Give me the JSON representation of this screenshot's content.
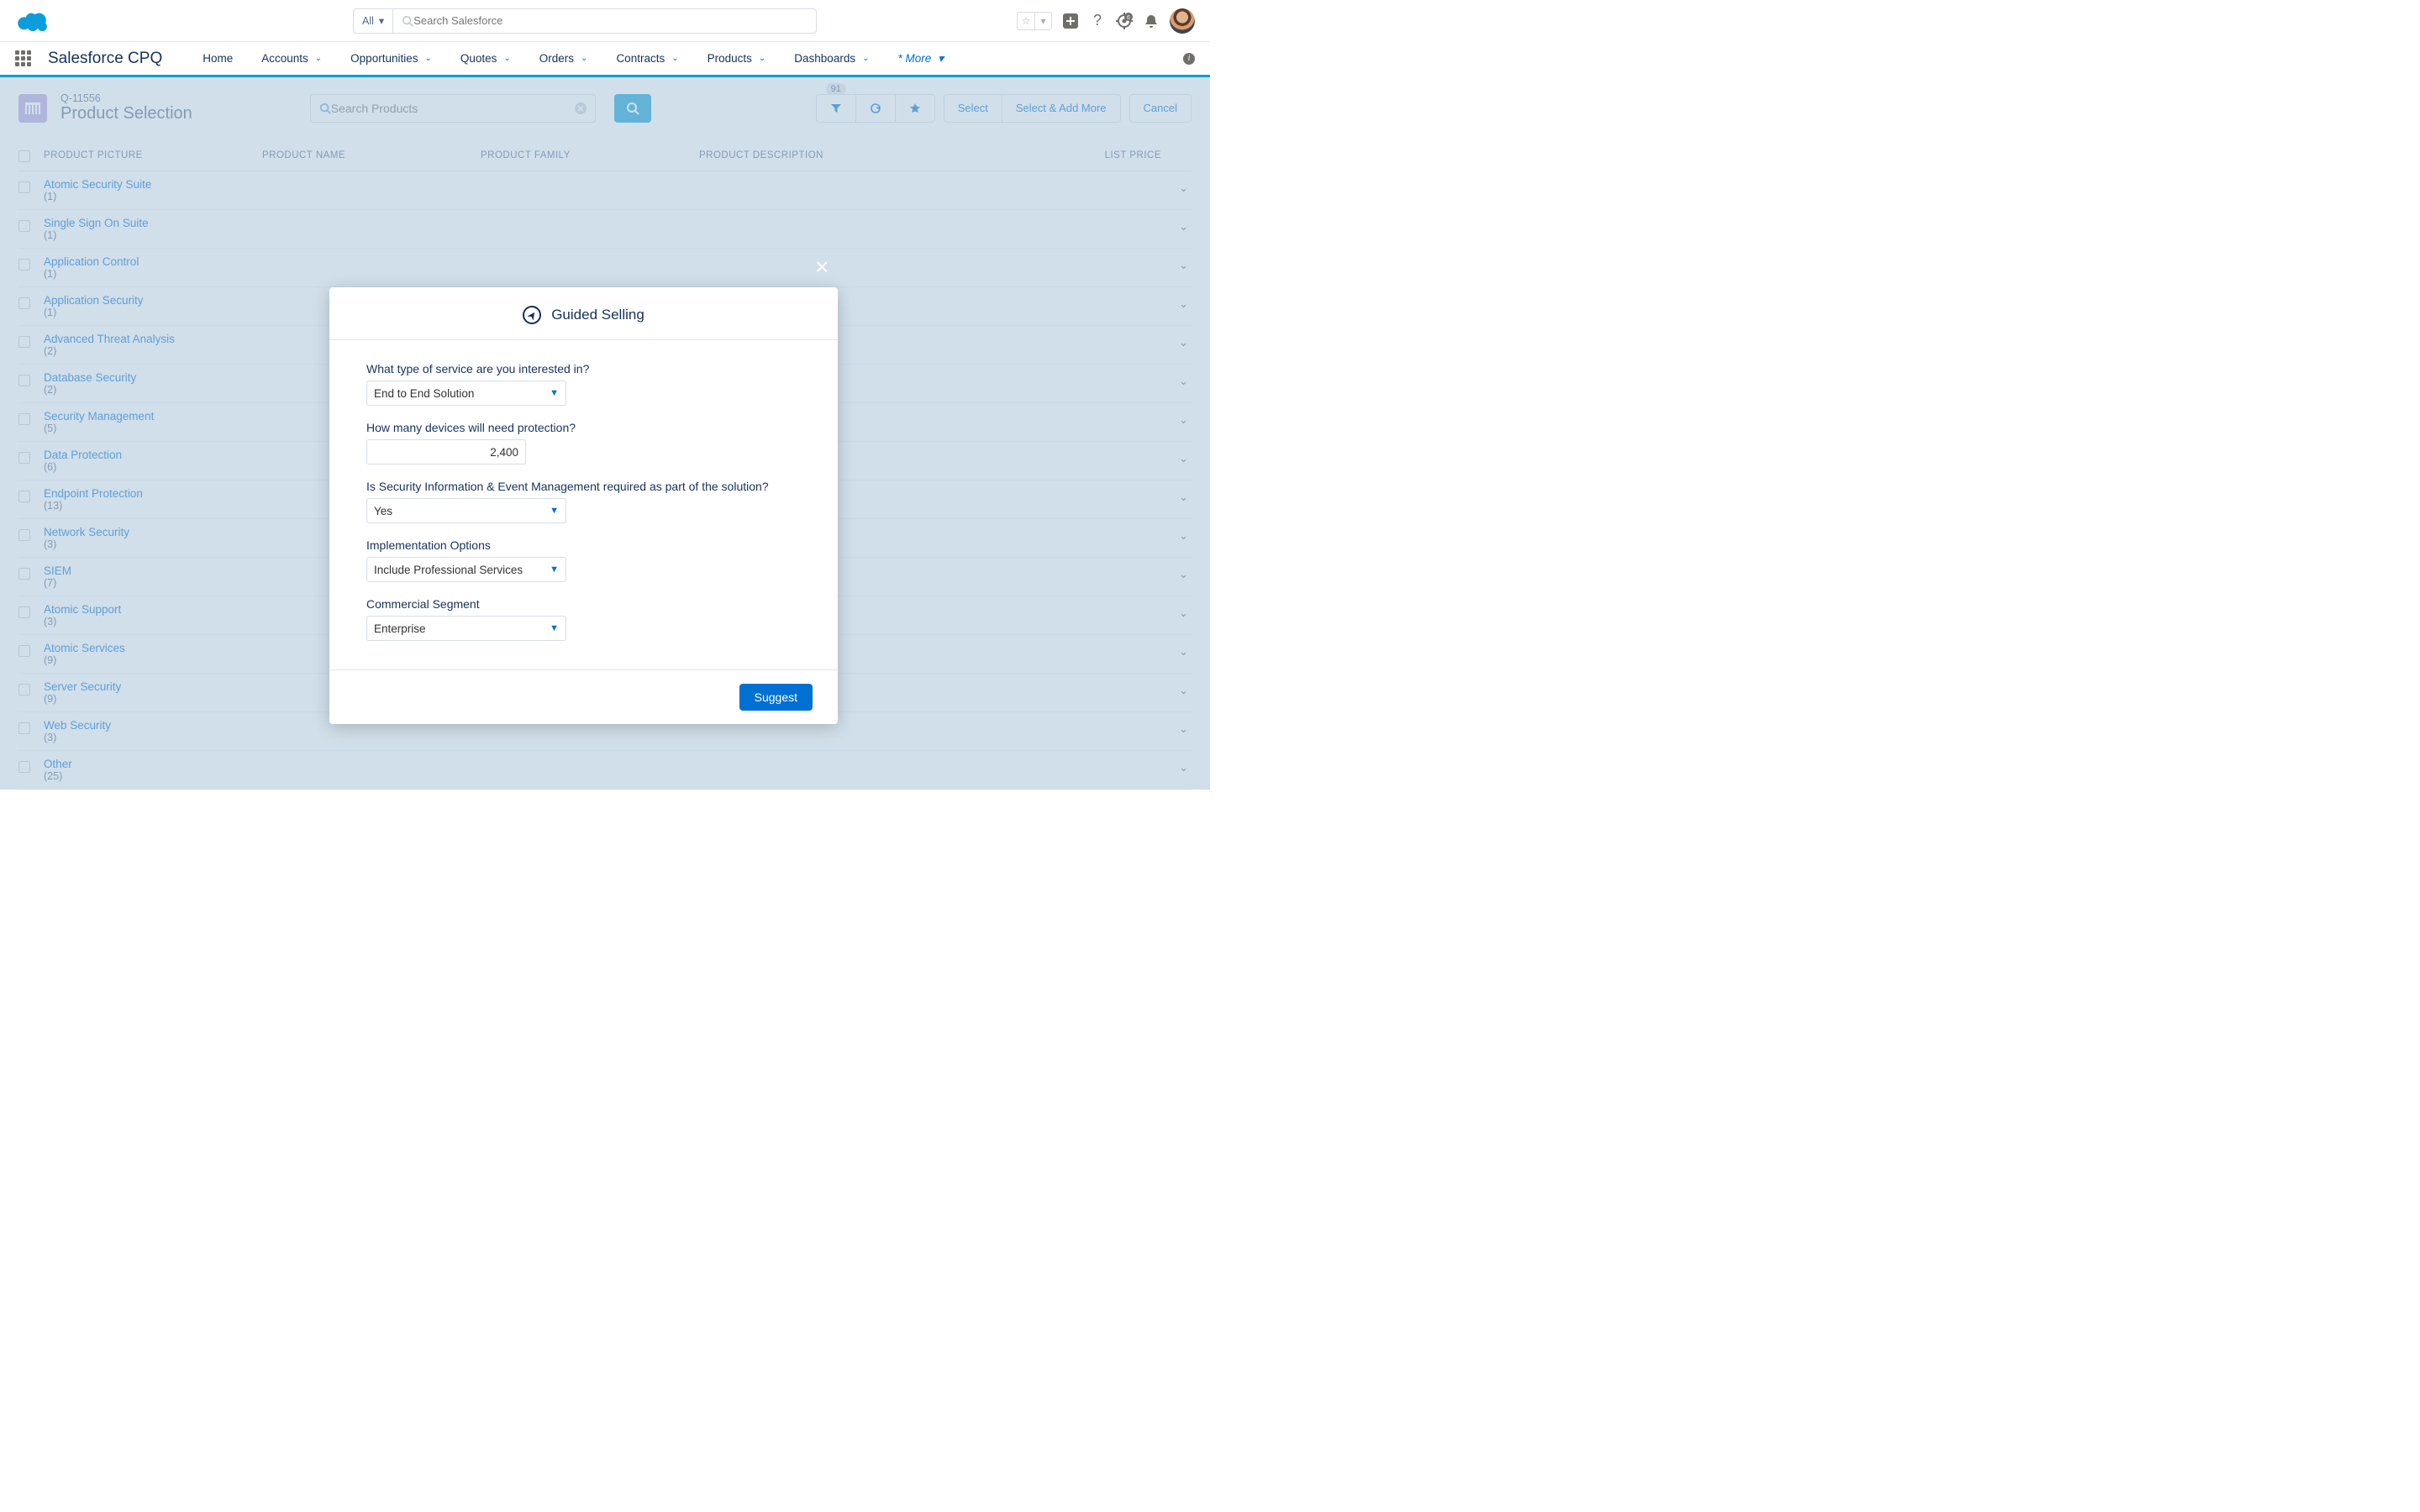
{
  "header": {
    "search_scope": "All",
    "search_placeholder": "Search Salesforce"
  },
  "nav": {
    "app_name": "Salesforce CPQ",
    "items": [
      "Home",
      "Accounts",
      "Opportunities",
      "Quotes",
      "Orders",
      "Contracts",
      "Products",
      "Dashboards"
    ],
    "more_label": "* More"
  },
  "page": {
    "record_code": "Q-11556",
    "title": "Product Selection",
    "product_search_placeholder": "Search Products",
    "filter_count": "91",
    "buttons": {
      "select": "Select",
      "select_add": "Select & Add More",
      "cancel": "Cancel"
    },
    "columns": {
      "pic": "PRODUCT PICTURE",
      "name": "PRODUCT NAME",
      "family": "PRODUCT FAMILY",
      "desc": "PRODUCT DESCRIPTION",
      "price": "LIST PRICE"
    }
  },
  "rows": [
    {
      "name": "Atomic Security Suite",
      "cnt": "(1)"
    },
    {
      "name": "Single Sign On Suite",
      "cnt": "(1)"
    },
    {
      "name": "Application Control",
      "cnt": "(1)"
    },
    {
      "name": "Application Security",
      "cnt": "(1)"
    },
    {
      "name": "Advanced Threat Analysis",
      "cnt": "(2)"
    },
    {
      "name": "Database Security",
      "cnt": "(2)"
    },
    {
      "name": "Security Management",
      "cnt": "(5)"
    },
    {
      "name": "Data Protection",
      "cnt": "(6)"
    },
    {
      "name": "Endpoint Protection",
      "cnt": "(13)"
    },
    {
      "name": "Network Security",
      "cnt": "(3)"
    },
    {
      "name": "SIEM",
      "cnt": "(7)"
    },
    {
      "name": "Atomic Support",
      "cnt": "(3)"
    },
    {
      "name": "Atomic Services",
      "cnt": "(9)"
    },
    {
      "name": "Server Security",
      "cnt": "(9)"
    },
    {
      "name": "Web Security",
      "cnt": "(3)"
    },
    {
      "name": "Other",
      "cnt": "(25)"
    }
  ],
  "modal": {
    "title": "Guided Selling",
    "q1_label": "What type of service are you interested in?",
    "q1_value": "End to End Solution",
    "q2_label": "How many devices will need protection?",
    "q2_value": "2,400",
    "q3_label": "Is Security Information & Event Management required as part of the solution?",
    "q3_value": "Yes",
    "q4_label": "Implementation Options",
    "q4_value": "Include Professional Services",
    "q5_label": "Commercial Segment",
    "q5_value": "Enterprise",
    "suggest": "Suggest"
  }
}
